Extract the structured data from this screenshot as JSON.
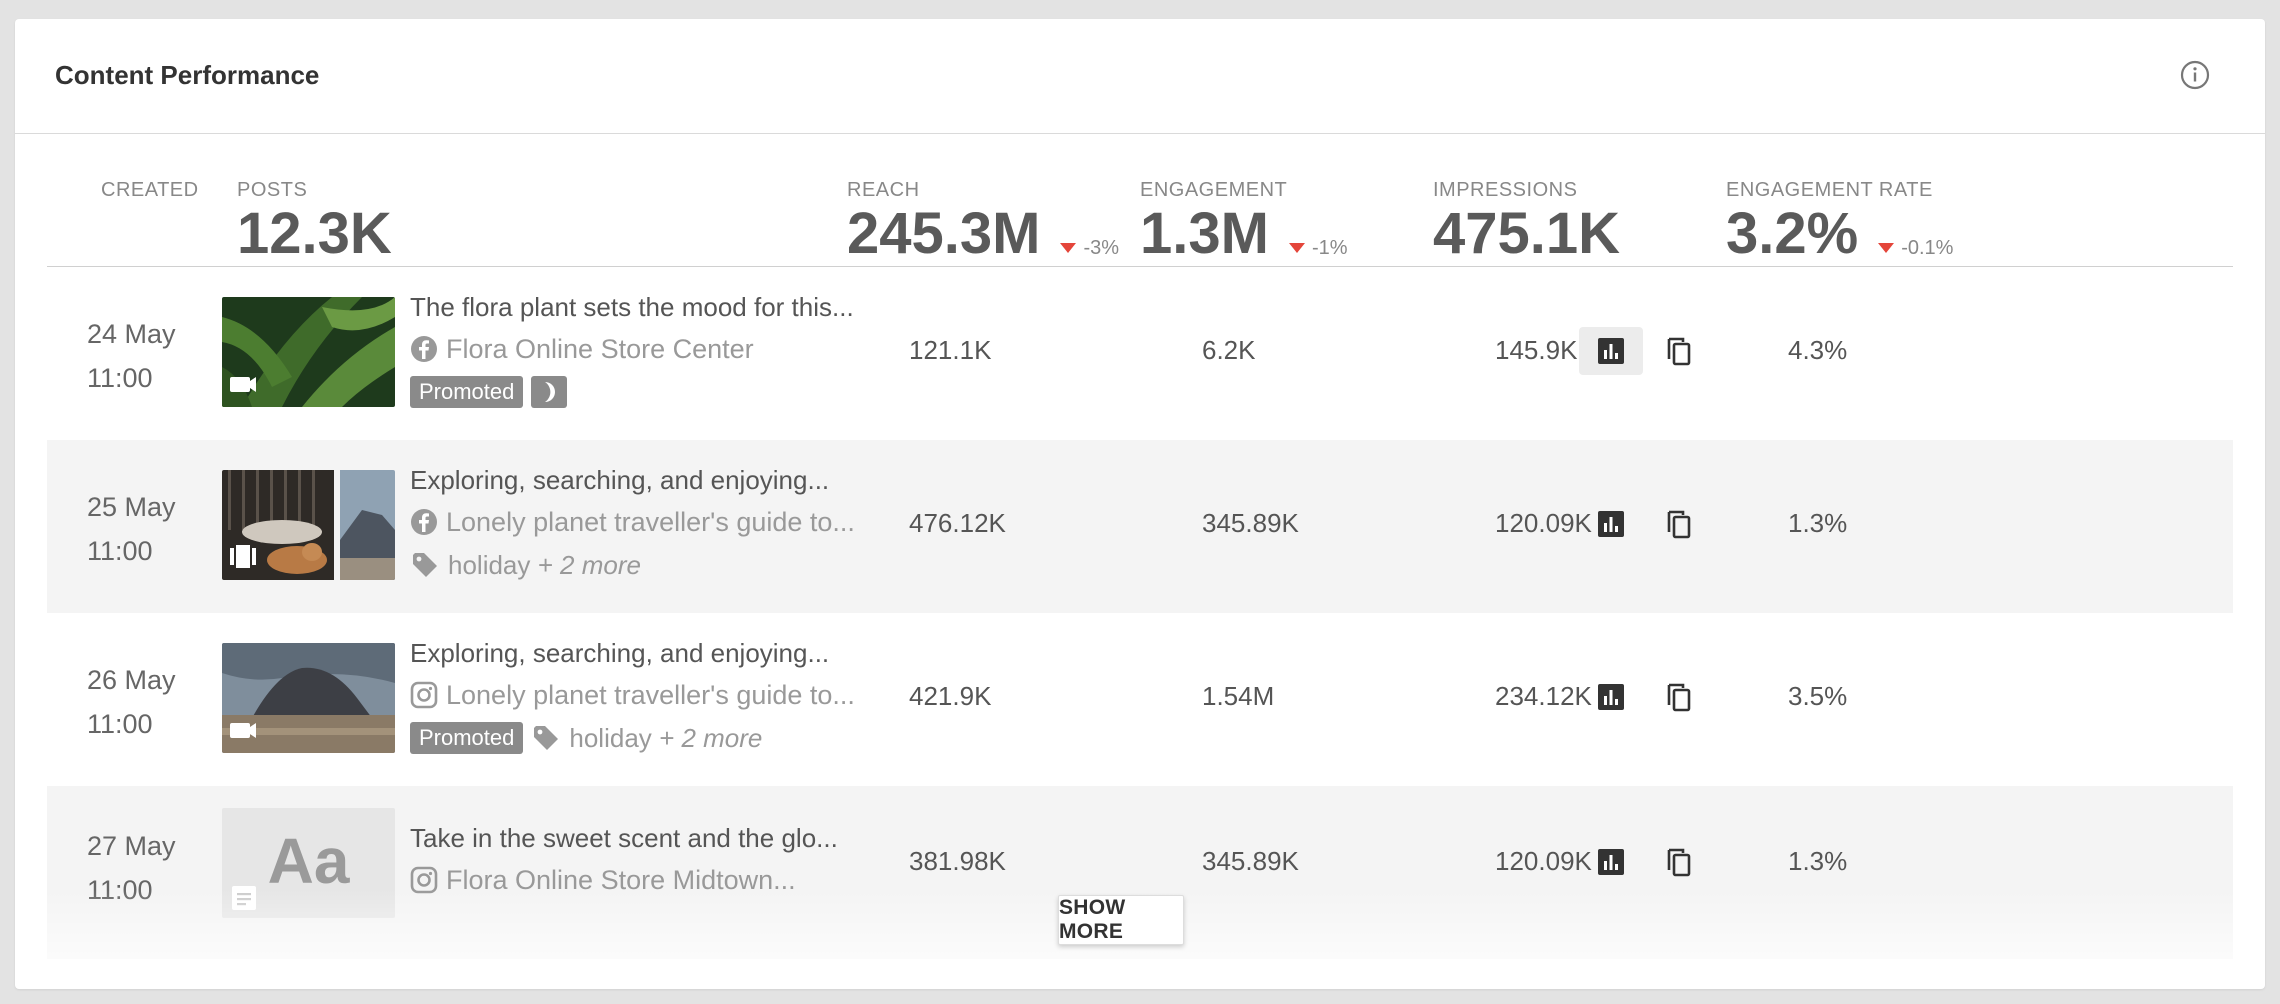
{
  "header": {
    "title": "Content Performance",
    "info_icon": "info-icon"
  },
  "summary": {
    "created_label": "CREATED",
    "posts": {
      "label": "POSTS",
      "value": "12.3K"
    },
    "reach": {
      "label": "REACH",
      "value": "245.3M",
      "delta": "-3%"
    },
    "engagement": {
      "label": "ENGAGEMENT",
      "value": "1.3M",
      "delta": "-1%"
    },
    "impressions": {
      "label": "IMPRESSIONS",
      "value": "475.1K"
    },
    "engagement_rate": {
      "label": "ENGAGEMENT RATE",
      "value": "3.2%",
      "delta": "-0.1%"
    }
  },
  "rows": [
    {
      "date": "24 May",
      "time": "11:00",
      "title": "The flora plant sets the mood for this...",
      "network": "facebook-icon",
      "source": "Flora Online Store Center",
      "promoted": "Promoted",
      "reach": "121.1K",
      "engagement": "6.2K",
      "impressions": "145.9K",
      "rate": "4.3%"
    },
    {
      "date": "25 May",
      "time": "11:00",
      "title": "Exploring, searching, and enjoying...",
      "network": "facebook-icon",
      "source": "Lonely planet traveller's guide to...",
      "tag": "holiday",
      "tag_more": "+ 2 more",
      "reach": "476.12K",
      "engagement": "345.89K",
      "impressions": "120.09K",
      "rate": "1.3%"
    },
    {
      "date": "26 May",
      "time": "11:00",
      "title": "Exploring, searching, and enjoying...",
      "network": "instagram-icon",
      "source": "Lonely planet traveller's guide to...",
      "promoted": "Promoted",
      "tag": "holiday",
      "tag_more": "+ 2 more",
      "reach": "421.9K",
      "engagement": "1.54M",
      "impressions": "234.12K",
      "rate": "3.5%"
    },
    {
      "date": "27 May",
      "time": "11:00",
      "title": "Take in the sweet scent and the glo...",
      "network": "instagram-icon",
      "source": "Flora Online Store Midtown...",
      "thumb_text": "Aa",
      "reach": "381.98K",
      "engagement": "345.89K",
      "impressions": "120.09K",
      "rate": "1.3%"
    }
  ],
  "show_more_label": "SHOW MORE",
  "colors": {
    "negative": "#e4453a",
    "badge": "#8a8a8a",
    "alt_row": "#f4f4f4"
  }
}
